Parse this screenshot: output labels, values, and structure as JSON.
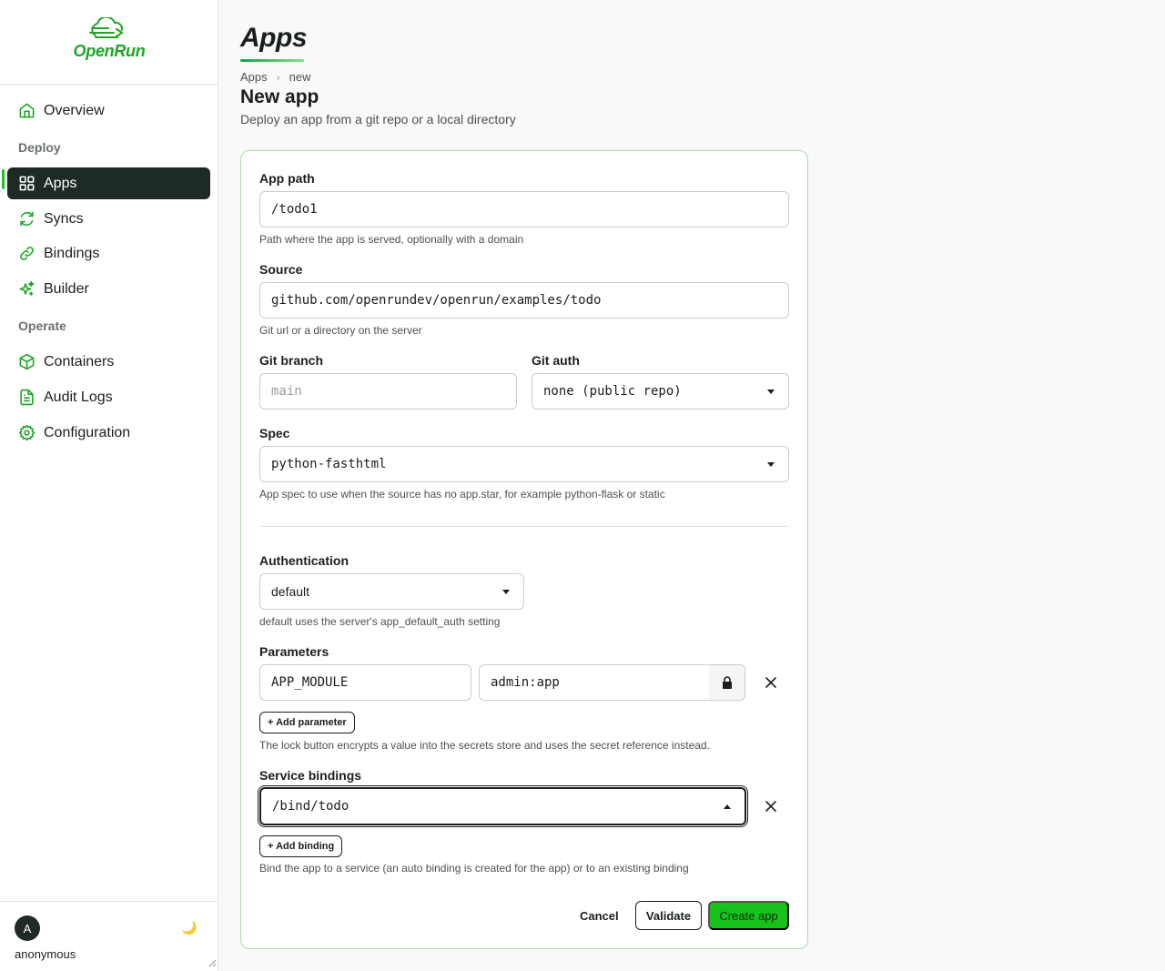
{
  "brand": {
    "name": "OpenRun",
    "accent": "#1ec425"
  },
  "nav": {
    "overview": "Overview",
    "deploy_section": "Deploy",
    "apps": "Apps",
    "syncs": "Syncs",
    "bindings": "Bindings",
    "builder": "Builder",
    "operate_section": "Operate",
    "containers": "Containers",
    "audit_logs": "Audit Logs",
    "configuration": "Configuration"
  },
  "user": {
    "initial": "A",
    "name": "anonymous",
    "theme_icon": "🌙"
  },
  "page": {
    "title": "Apps",
    "breadcrumb": [
      "Apps",
      "new"
    ],
    "heading": "New app",
    "subheading": "Deploy an app from a git repo or a local directory"
  },
  "form": {
    "app_path": {
      "label": "App path",
      "value": "/todo1",
      "hint": "Path where the app is served, optionally with a domain"
    },
    "source": {
      "label": "Source",
      "value": "github.com/openrundev/openrun/examples/todo",
      "hint": "Git url or a directory on the server"
    },
    "git_branch": {
      "label": "Git branch",
      "placeholder": "main"
    },
    "git_auth": {
      "label": "Git auth",
      "value": "none (public repo)"
    },
    "spec": {
      "label": "Spec",
      "value": "python-fasthtml",
      "hint": "App spec to use when the source has no app.star, for example python-flask or static"
    },
    "authentication": {
      "label": "Authentication",
      "value": "default",
      "hint": "default uses the server's app_default_auth setting"
    },
    "parameters": {
      "label": "Parameters",
      "rows": [
        {
          "key": "APP_MODULE",
          "value": "admin:app"
        }
      ],
      "add_label": "+ Add parameter",
      "hint": "The lock button encrypts a value into the secrets store and uses the secret reference instead."
    },
    "service_bindings": {
      "label": "Service bindings",
      "value": "/bind/todo",
      "add_label": "+ Add binding",
      "hint": "Bind the app to a service (an auto binding is created for the app) or to an existing binding"
    },
    "actions": {
      "cancel": "Cancel",
      "validate": "Validate",
      "create": "Create app"
    }
  }
}
